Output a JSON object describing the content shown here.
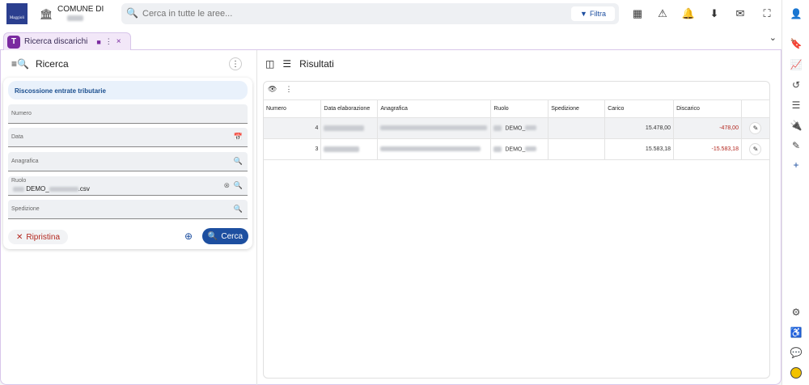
{
  "header": {
    "comune_label": "COMUNE DI",
    "logo_text": "Maggioli",
    "search_placeholder": "Cerca in tutte le aree...",
    "filter_label": "Filtra",
    "icons": [
      "dashboard-icon",
      "warning-icon",
      "bell-icon",
      "download-icon",
      "mail-icon",
      "fullscreen-icon",
      "account-icon"
    ]
  },
  "tab": {
    "label": "Ricerca discarichi",
    "icon_letter": "T"
  },
  "left": {
    "title": "Ricerca",
    "category": "Riscossione entrate tributarie",
    "fields": {
      "numero": {
        "label": "Numero",
        "value": ""
      },
      "data": {
        "label": "Data",
        "value": ""
      },
      "anagrafica": {
        "label": "Anagrafica",
        "value": ""
      },
      "ruolo": {
        "label": "Ruolo",
        "value_prefix": "DEMO_",
        "value_suffix": ".csv"
      },
      "spedizione": {
        "label": "Spedizione",
        "value": ""
      }
    },
    "reset_label": "Ripristina",
    "search_label": "Cerca"
  },
  "right": {
    "title": "Risultati",
    "columns": [
      "Numero",
      "Data elaborazione",
      "Anagrafica",
      "Ruolo",
      "Spedizione",
      "Carico",
      "Discarico",
      ""
    ],
    "rows": [
      {
        "numero": "4",
        "ruolo": "DEMO_",
        "carico": "15.478,00",
        "discarico": "-478,00"
      },
      {
        "numero": "3",
        "ruolo": "DEMO_",
        "carico": "15.583,18",
        "discarico": "-15.583,18"
      }
    ]
  },
  "colors": {
    "primary": "#1d4fa0",
    "danger": "#b3261e",
    "tab_bg": "#f2e7f8",
    "tab_icon": "#7a2aa0"
  }
}
